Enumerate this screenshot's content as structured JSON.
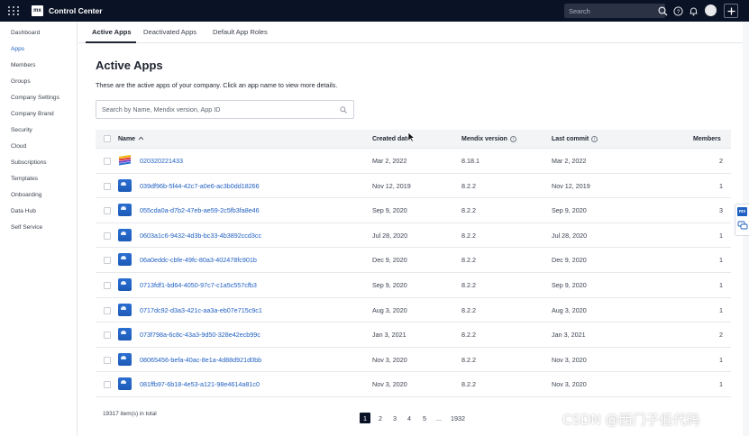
{
  "topbar": {
    "logo": "mx",
    "title": "Control Center",
    "search_placeholder": "Search"
  },
  "sidebar": {
    "items": [
      {
        "label": "Dashboard"
      },
      {
        "label": "Apps"
      },
      {
        "label": "Members"
      },
      {
        "label": "Groups"
      },
      {
        "label": "Company Settings"
      },
      {
        "label": "Company Brand"
      },
      {
        "label": "Security"
      },
      {
        "label": "Cloud"
      },
      {
        "label": "Subscriptions"
      },
      {
        "label": "Templates"
      },
      {
        "label": "Onboarding"
      },
      {
        "label": "Data Hub"
      },
      {
        "label": "Self Service"
      }
    ],
    "active_index": 1
  },
  "tabs": [
    {
      "label": "Active Apps"
    },
    {
      "label": "Deactivated Apps"
    },
    {
      "label": "Default App Roles"
    }
  ],
  "main": {
    "title": "Active Apps",
    "description": "These are the active apps of your company. Click an app name to view more details.",
    "search_placeholder": "Search by Name, Mendix version, App ID"
  },
  "table": {
    "headers": {
      "name": "Name",
      "sort_indicator": "^",
      "created": "Created date",
      "version": "Mendix version",
      "last_commit": "Last commit",
      "members": "Members"
    },
    "rows": [
      {
        "icon": "rainbow-app-icon",
        "name": "020320221433",
        "created": "Mar 2, 2022",
        "version": "8.18.1",
        "last_commit": "Mar 2, 2022",
        "members": "2"
      },
      {
        "icon": "cloud-app-icon",
        "name": "039df96b-5f44-42c7-a0e6-ac3b0dd18266",
        "created": "Nov 12, 2019",
        "version": "8.2.2",
        "last_commit": "Nov 12, 2019",
        "members": "1"
      },
      {
        "icon": "cloud-app-icon",
        "name": "055cda0a-d7b2-47eb-ae59-2c5fb3fa8e46",
        "created": "Sep 9, 2020",
        "version": "8.2.2",
        "last_commit": "Sep 9, 2020",
        "members": "3"
      },
      {
        "icon": "cloud-app-icon",
        "name": "0603a1c6-9432-4d3b-bc33-4b3892ccd3cc",
        "created": "Jul 28, 2020",
        "version": "8.2.2",
        "last_commit": "Jul 28, 2020",
        "members": "1"
      },
      {
        "icon": "cloud-app-icon",
        "name": "06a0eddc-cbfe-49fc-80a3-402478fc901b",
        "created": "Dec 9, 2020",
        "version": "8.2.2",
        "last_commit": "Dec 9, 2020",
        "members": "1"
      },
      {
        "icon": "cloud-app-icon",
        "name": "0713fdf1-bd64-4050-97c7-c1a5c557cfb3",
        "created": "Sep 9, 2020",
        "version": "8.2.2",
        "last_commit": "Sep 9, 2020",
        "members": "1"
      },
      {
        "icon": "cloud-app-icon",
        "name": "0717dc92-d3a3-421c-aa3a-eb07e715c9c1",
        "created": "Aug 3, 2020",
        "version": "8.2.2",
        "last_commit": "Aug 3, 2020",
        "members": "1"
      },
      {
        "icon": "cloud-app-icon",
        "name": "073f798a-6c8c-43a3-9d50-328e42ecb99c",
        "created": "Jan 3, 2021",
        "version": "8.2.2",
        "last_commit": "Jan 3, 2021",
        "members": "2"
      },
      {
        "icon": "cloud-app-icon",
        "name": "08065456-befa-40ac-8e1a-4d88d921d0bb",
        "created": "Nov 3, 2020",
        "version": "8.2.2",
        "last_commit": "Nov 3, 2020",
        "members": "1"
      },
      {
        "icon": "cloud-app-icon",
        "name": "081ffb97-6b18-4e53-a121-98e4614a81c0",
        "created": "Nov 3, 2020",
        "version": "8.2.2",
        "last_commit": "Nov 3, 2020",
        "members": "1"
      }
    ]
  },
  "footer": {
    "total": "19317 item(s) in total",
    "pages": [
      "1",
      "2",
      "3",
      "4",
      "5",
      "...",
      "1932"
    ],
    "current_page": "1"
  },
  "floating": {
    "badge": "mx"
  },
  "watermark": "CSDN @西门子低代码",
  "colors": {
    "topbar_bg": "#0a1325",
    "link_blue": "#1f5fc2",
    "header_bg": "#f3f4f6"
  }
}
